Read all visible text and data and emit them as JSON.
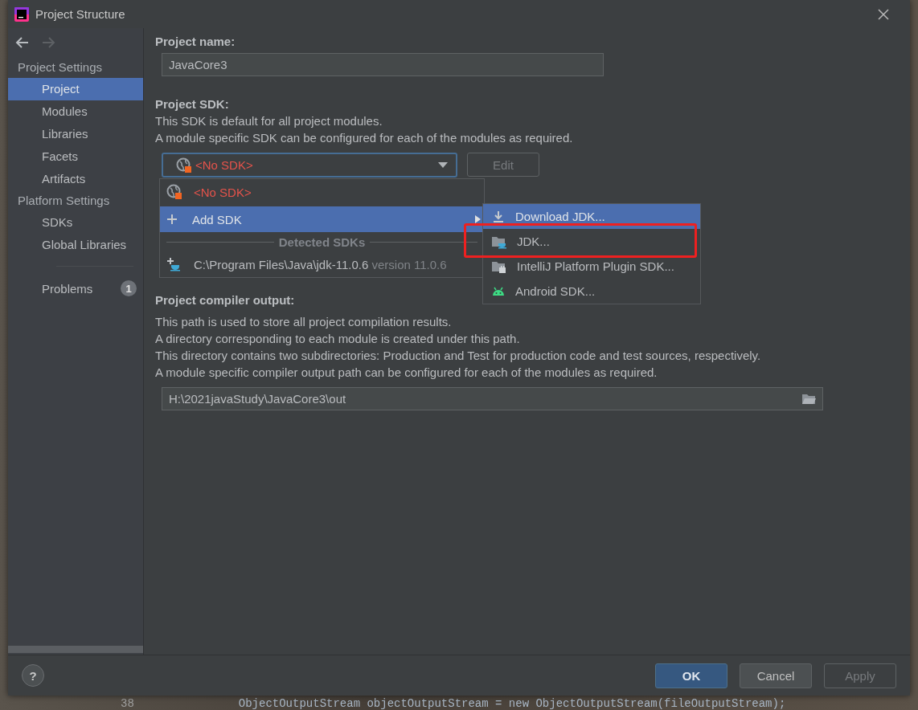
{
  "window": {
    "title": "Project Structure"
  },
  "nav_buttons": [
    {
      "kind": "back",
      "disabled": false
    },
    {
      "kind": "forward",
      "disabled": true
    }
  ],
  "sidebar": {
    "groups": [
      {
        "heading": "Project Settings",
        "items": [
          {
            "label": "Project",
            "selected": true
          },
          {
            "label": "Modules",
            "selected": false
          },
          {
            "label": "Libraries",
            "selected": false
          },
          {
            "label": "Facets",
            "selected": false
          },
          {
            "label": "Artifacts",
            "selected": false
          }
        ]
      },
      {
        "heading": "Platform Settings",
        "items": [
          {
            "label": "SDKs",
            "selected": false
          },
          {
            "label": "Global Libraries",
            "selected": false
          }
        ]
      }
    ],
    "problems": {
      "label": "Problems",
      "count": "1"
    }
  },
  "project_name": {
    "label": "Project name:",
    "value": "JavaCore3"
  },
  "project_sdk": {
    "label": "Project SDK:",
    "lines": [
      "This SDK is default for all project modules.",
      "A module specific SDK can be configured for each of the modules as required."
    ],
    "value": "<No SDK>",
    "edit_button": {
      "label": "Edit",
      "disabled": true
    }
  },
  "compiler_output": {
    "label": "Project compiler output:",
    "lines": [
      "This path is used to store all project compilation results.",
      "A directory corresponding to each module is created under this path.",
      "This directory contains two subdirectories: Production and Test for production code and test sources, respectively.",
      "A module specific compiler output path can be configured for each of the modules as required."
    ],
    "value": "H:\\2021javaStudy\\JavaCore3\\out"
  },
  "sdk_popup": {
    "items": [
      {
        "kind": "none",
        "label": "<No SDK>",
        "selected": false
      },
      {
        "kind": "submenu",
        "label": "Add SDK",
        "selected": true
      },
      {
        "kind": "separator",
        "label": "Detected SDKs"
      },
      {
        "kind": "detected",
        "label": "C:\\Program Files\\Java\\jdk-11.0.6",
        "version": "version 11.0.6",
        "selected": false
      }
    ]
  },
  "add_sdk_menu": {
    "items": [
      {
        "kind": "download",
        "label": "Download JDK...",
        "selected": true,
        "highlighted": false
      },
      {
        "kind": "jdk",
        "label": "JDK...",
        "selected": false,
        "highlighted": true
      },
      {
        "kind": "plugin",
        "label": "IntelliJ Platform Plugin SDK...",
        "selected": false,
        "highlighted": false
      },
      {
        "kind": "android",
        "label": "Android SDK...",
        "selected": false,
        "highlighted": false
      }
    ]
  },
  "help_button": {
    "label": "?"
  },
  "buttons": [
    {
      "kind": "primary",
      "label": "OK",
      "disabled": false
    },
    {
      "kind": "normal",
      "label": "Cancel",
      "disabled": false
    },
    {
      "kind": "normal",
      "label": "Apply",
      "disabled": true
    }
  ],
  "background_editor": {
    "line_number": "38",
    "code": "ObjectOutputStream objectOutputStream = new ObjectOutputStream(fileOutputStream);"
  }
}
